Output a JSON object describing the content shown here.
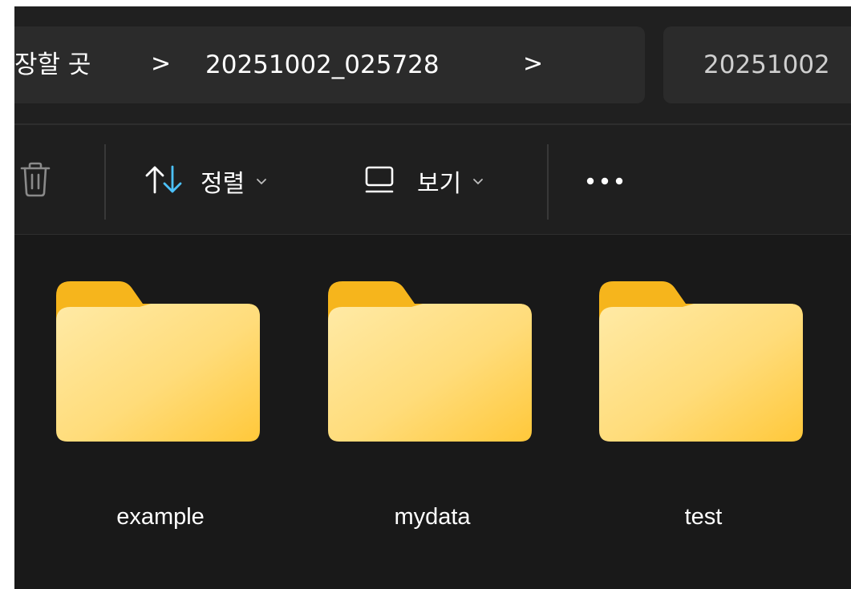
{
  "address_bar": {
    "breadcrumbs": [
      "장할 곳",
      "20251002_025728"
    ],
    "separator": ">",
    "search_text": "20251002"
  },
  "toolbar": {
    "delete_icon": "trash-icon",
    "sort_label": "정렬",
    "sort_icon": "sort-arrows-icon",
    "view_label": "보기",
    "view_icon": "view-square-icon",
    "more_icon": "more-ellipsis-icon"
  },
  "folders": [
    {
      "name": "example",
      "icon": "folder-icon"
    },
    {
      "name": "mydata",
      "icon": "folder-icon"
    },
    {
      "name": "test",
      "icon": "folder-icon"
    }
  ],
  "colors": {
    "background": "#191919",
    "bar": "#2b2b2b",
    "text": "#ffffff",
    "folder_light": "#ffe7a0",
    "folder_dark": "#f6b51c",
    "accent_blue": "#4cc2ff"
  }
}
